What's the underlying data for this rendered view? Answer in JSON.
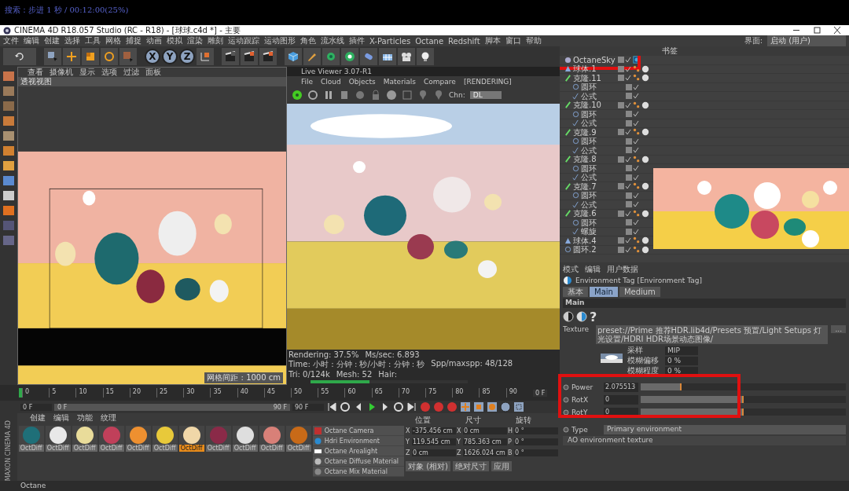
{
  "overlay_caption": "搜索：步进 1 秒 / 00:12:00(25%)",
  "window": {
    "title": "CINEMA 4D R18.057 Studio (RC - R18) - [球球.c4d *] - 主要"
  },
  "menu": [
    "文件",
    "编辑",
    "创建",
    "选择",
    "工具",
    "网格",
    "捕捉",
    "动画",
    "模拟",
    "渲染",
    "雕刻",
    "运动跟踪",
    "运动图形",
    "角色",
    "流水线",
    "插件",
    "X-Particles",
    "Octane",
    "Redshift",
    "脚本",
    "窗口",
    "帮助"
  ],
  "layout_selector": {
    "label": "界面:",
    "value": "启动 (用户)"
  },
  "axis_buttons": [
    "X",
    "Y",
    "Z"
  ],
  "viewport": {
    "menu": [
      "查看",
      "摄像机",
      "显示",
      "选项",
      "过滤",
      "面板"
    ],
    "label": "透视视图",
    "grid_spacing": "网格间距 : 1000 cm"
  },
  "live_viewer": {
    "title": "Live Viewer 3.07-R1",
    "menu": [
      "File",
      "Cloud",
      "Objects",
      "Materials",
      "Compare"
    ],
    "state": "[RENDERING]",
    "channel_label": "Chn:",
    "channel": "DL",
    "status": [
      "Rendering: 37.5%",
      "Ms/sec: 6.893",
      "Time: 小时 : 分钟 : 秒/小时 : 分钟 : 秒",
      "Spp/maxspp: 48/128",
      "Tri: 0/124k",
      "Mesh: 52",
      "Hair:"
    ],
    "progress": {
      "level": 0.375
    }
  },
  "object_manager": {
    "menu": [
      "书签"
    ],
    "objects": [
      {
        "name": "OctaneSky",
        "kind": "sky"
      },
      {
        "name": "球体.1",
        "kind": "sphere"
      },
      {
        "name": "克隆.11",
        "kind": "cloner",
        "children": [
          {
            "name": "圆环",
            "kind": "circle"
          },
          {
            "name": "公式",
            "kind": "formula"
          }
        ]
      },
      {
        "name": "克隆.10",
        "kind": "cloner",
        "children": [
          {
            "name": "圆环",
            "kind": "circle"
          },
          {
            "name": "公式",
            "kind": "formula"
          }
        ]
      },
      {
        "name": "克隆.9",
        "kind": "cloner",
        "children": [
          {
            "name": "圆环",
            "kind": "circle"
          },
          {
            "name": "公式",
            "kind": "formula"
          }
        ]
      },
      {
        "name": "克隆.8",
        "kind": "cloner",
        "children": [
          {
            "name": "圆环",
            "kind": "circle"
          },
          {
            "name": "公式",
            "kind": "formula"
          }
        ]
      },
      {
        "name": "克隆.7",
        "kind": "cloner",
        "children": [
          {
            "name": "圆环",
            "kind": "circle"
          },
          {
            "name": "公式",
            "kind": "formula"
          }
        ]
      },
      {
        "name": "克隆.6",
        "kind": "cloner",
        "children": [
          {
            "name": "圆环",
            "kind": "circle"
          },
          {
            "name": "螺旋",
            "kind": "formula"
          }
        ]
      },
      {
        "name": "球体.4",
        "kind": "sphere"
      },
      {
        "name": "圆环.2",
        "kind": "circle"
      }
    ]
  },
  "attributes": {
    "menu": [
      "模式",
      "编辑",
      "用户数据"
    ],
    "title": "Environment Tag [Environment Tag]",
    "tabs": [
      {
        "label": "基本",
        "selected": false
      },
      {
        "label": "Main",
        "selected": true
      },
      {
        "label": "Medium",
        "selected": false
      }
    ],
    "section": "Main",
    "help": "?",
    "texture_label": "Texture",
    "texture_path": "preset://Prime 推荐HDR.lib4d/Presets 预置/Light Setups 灯光设置/HDRI HDR场景动态图像/",
    "browse": "...",
    "texture_options": [
      {
        "label": "采样",
        "value": "MIP"
      },
      {
        "label": "模糊偏移",
        "value": "0 %"
      },
      {
        "label": "模糊程度",
        "value": "0 %"
      }
    ],
    "params": [
      {
        "label": "Power",
        "value": "2.075513",
        "level": 0.2
      },
      {
        "label": "RotX",
        "value": "0",
        "level": 0.5
      },
      {
        "label": "RotY",
        "value": "0",
        "level": 0.5
      }
    ],
    "type_label": "Type",
    "type_value": "Primary environment",
    "ao": "AO environment texture"
  },
  "timeline": {
    "ticks": [
      "0",
      "5",
      "10",
      "15",
      "20",
      "25",
      "30",
      "35",
      "40",
      "45",
      "50",
      "55",
      "60",
      "65",
      "70",
      "75",
      "80",
      "85",
      "90"
    ],
    "end_label": "0 F",
    "start": "0 F",
    "range_start": "0 F",
    "range_end": "90 F",
    "end": "90 F"
  },
  "materials": {
    "menu": [
      "创建",
      "编辑",
      "功能",
      "纹理"
    ],
    "items": [
      {
        "name": "OctDiff",
        "color": "#1f6f78",
        "selected": false
      },
      {
        "name": "OctDiff",
        "color": "#e8e8e8",
        "selected": false
      },
      {
        "name": "OctDiff",
        "color": "#e9dc9a",
        "selected": false
      },
      {
        "name": "OctDiff",
        "color": "#c0405a",
        "selected": false
      },
      {
        "name": "OctDiff",
        "color": "#ee9030",
        "selected": false
      },
      {
        "name": "OctDiff",
        "color": "#e8c93a",
        "selected": false
      },
      {
        "name": "OctDiff",
        "color": "#f0d7a8",
        "selected": true
      },
      {
        "name": "OctDiff",
        "color": "#8a2a48",
        "selected": false
      },
      {
        "name": "OctDiff",
        "color": "#dedede",
        "selected": false
      },
      {
        "name": "OctDiff",
        "color": "#d88078",
        "selected": false
      },
      {
        "name": "OctDiff",
        "color": "#c86a18",
        "selected": false
      }
    ]
  },
  "octane_menu": [
    {
      "label": "Octane Camera",
      "kind": "camera"
    },
    {
      "label": "Hdri Environment",
      "kind": "env"
    },
    {
      "label": "Octane Arealight",
      "kind": "light"
    },
    {
      "label": "Octane Diffuse Material",
      "kind": "material"
    },
    {
      "label": "Octane Mix Material",
      "kind": "mix"
    }
  ],
  "coordinates": {
    "headers": [
      "位置",
      "尺寸",
      "旋转"
    ],
    "rows": [
      {
        "axis": "X",
        "pos": "-375.456 cm",
        "size_axis": "X",
        "size": "0 cm",
        "rot_axis": "H",
        "rot": "0 °"
      },
      {
        "axis": "Y",
        "pos": "119.545 cm",
        "size_axis": "Y",
        "size": "785.363 cm",
        "rot_axis": "P",
        "rot": "0 °"
      },
      {
        "axis": "Z",
        "pos": "0 cm",
        "size_axis": "Z",
        "size": "1626.024 cm",
        "rot_axis": "B",
        "rot": "0 °"
      }
    ],
    "mode": "对象 (相对)",
    "size_mode": "绝对尺寸",
    "apply": "应用"
  },
  "brand": "MAXON CINEMA 4D",
  "status_bar": "Octane"
}
